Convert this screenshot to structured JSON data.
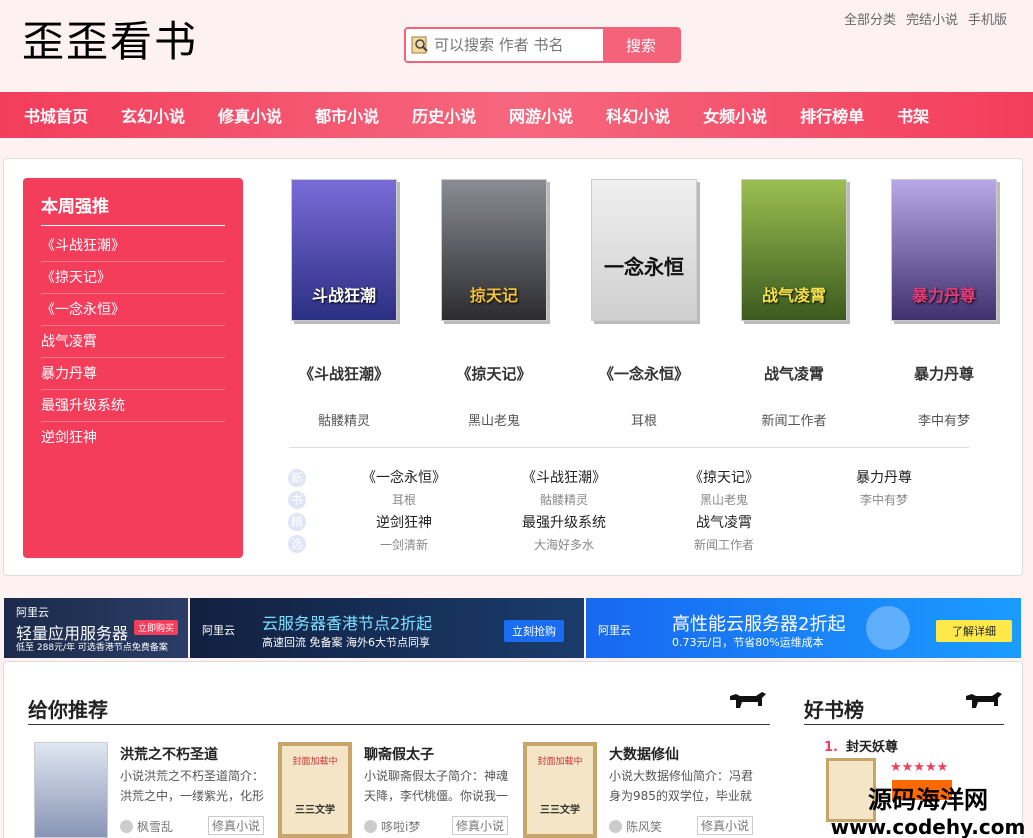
{
  "header": {
    "logo": "歪歪看书",
    "search_placeholder": "可以搜索 作者 书名",
    "search_button": "搜索",
    "top_links": [
      "全部分类",
      "完结小说",
      "手机版"
    ]
  },
  "nav": [
    "书城首页",
    "玄幻小说",
    "修真小说",
    "都市小说",
    "历史小说",
    "网游小说",
    "科幻小说",
    "女频小说",
    "排行榜单",
    "书架"
  ],
  "weekly": {
    "title": "本周强推",
    "items": [
      "《斗战狂潮》",
      "《掠天记》",
      "《一念永恒》",
      "战气凌霄",
      "暴力丹尊",
      "最强升级系统",
      "逆剑狂神"
    ]
  },
  "featured_books": [
    {
      "title": "《斗战狂潮》",
      "author": "骷髅精灵",
      "cover_text": "斗战狂潮",
      "color": "#3a3f9a"
    },
    {
      "title": "《掠天记》",
      "author": "黑山老鬼",
      "cover_text": "掠天记",
      "color": "#4a4f5c"
    },
    {
      "title": "《一念永恒》",
      "author": "耳根",
      "cover_text": "一念永恒",
      "color": "#e4e4e4"
    },
    {
      "title": "战气凌霄",
      "author": "新闻工作者",
      "cover_text": "战气凌霄",
      "color": "#6a8a3a"
    },
    {
      "title": "暴力丹尊",
      "author": "李中有梦",
      "cover_text": "暴力丹尊",
      "color": "#5a4c8c"
    }
  ],
  "new_label": [
    "新",
    "书",
    "精",
    "选"
  ],
  "new_books": [
    {
      "title": "《一念永恒》",
      "author": "耳根"
    },
    {
      "title": "《斗战狂潮》",
      "author": "骷髅精灵"
    },
    {
      "title": "《掠天记》",
      "author": "黑山老鬼"
    },
    {
      "title": "暴力丹尊",
      "author": "李中有梦"
    },
    {
      "title": "逆剑狂神",
      "author": "一剑清新"
    },
    {
      "title": "最强升级系统",
      "author": "大海好多水"
    },
    {
      "title": "战气凌霄",
      "author": "新闻工作者"
    }
  ],
  "ads": {
    "ad1": {
      "brand": "阿里云",
      "big": "轻量应用服务器",
      "small": "低至 288元/年 可选香港节点免费备案",
      "button": "立即购买"
    },
    "ad2": {
      "brand": "阿里云",
      "big": "云服务器香港节点2折起",
      "small": "高速回流  免备案  海外6大节点同享",
      "button": "立刻抢购"
    },
    "ad3": {
      "brand": "阿里云",
      "big": "高性能云服务器2折起",
      "small": "0.73元/日，节省80%运维成本",
      "button": "了解详细"
    }
  },
  "recommend": {
    "title": "给你推荐",
    "books": [
      {
        "title": "洪荒之不朽圣道",
        "desc": "小说洪荒之不朽圣道简介：洪荒之中，一缕紫光，化形",
        "author": "枫雪乱",
        "genre": "修真小说"
      },
      {
        "title": "聊斋假太子",
        "desc": "小说聊斋假太子简介：神魂天降，李代桃僵。你说我一",
        "author": "哆啦i梦",
        "genre": "修真小说"
      },
      {
        "title": "大数据修仙",
        "desc": "小说大数据修仙简介：冯君身为985的双学位，毕业就",
        "author": "陈风笑",
        "genre": "修真小说"
      }
    ]
  },
  "ranking": {
    "title": "好书榜",
    "first": {
      "num": "1.",
      "title": "封天妖尊",
      "stars": "★★★★★"
    }
  },
  "cover_placeholder": {
    "top": "封面加载中",
    "bottom": "三三文学"
  },
  "watermark": {
    "line1": "源码海洋网",
    "line2": "www.codehy.com"
  }
}
